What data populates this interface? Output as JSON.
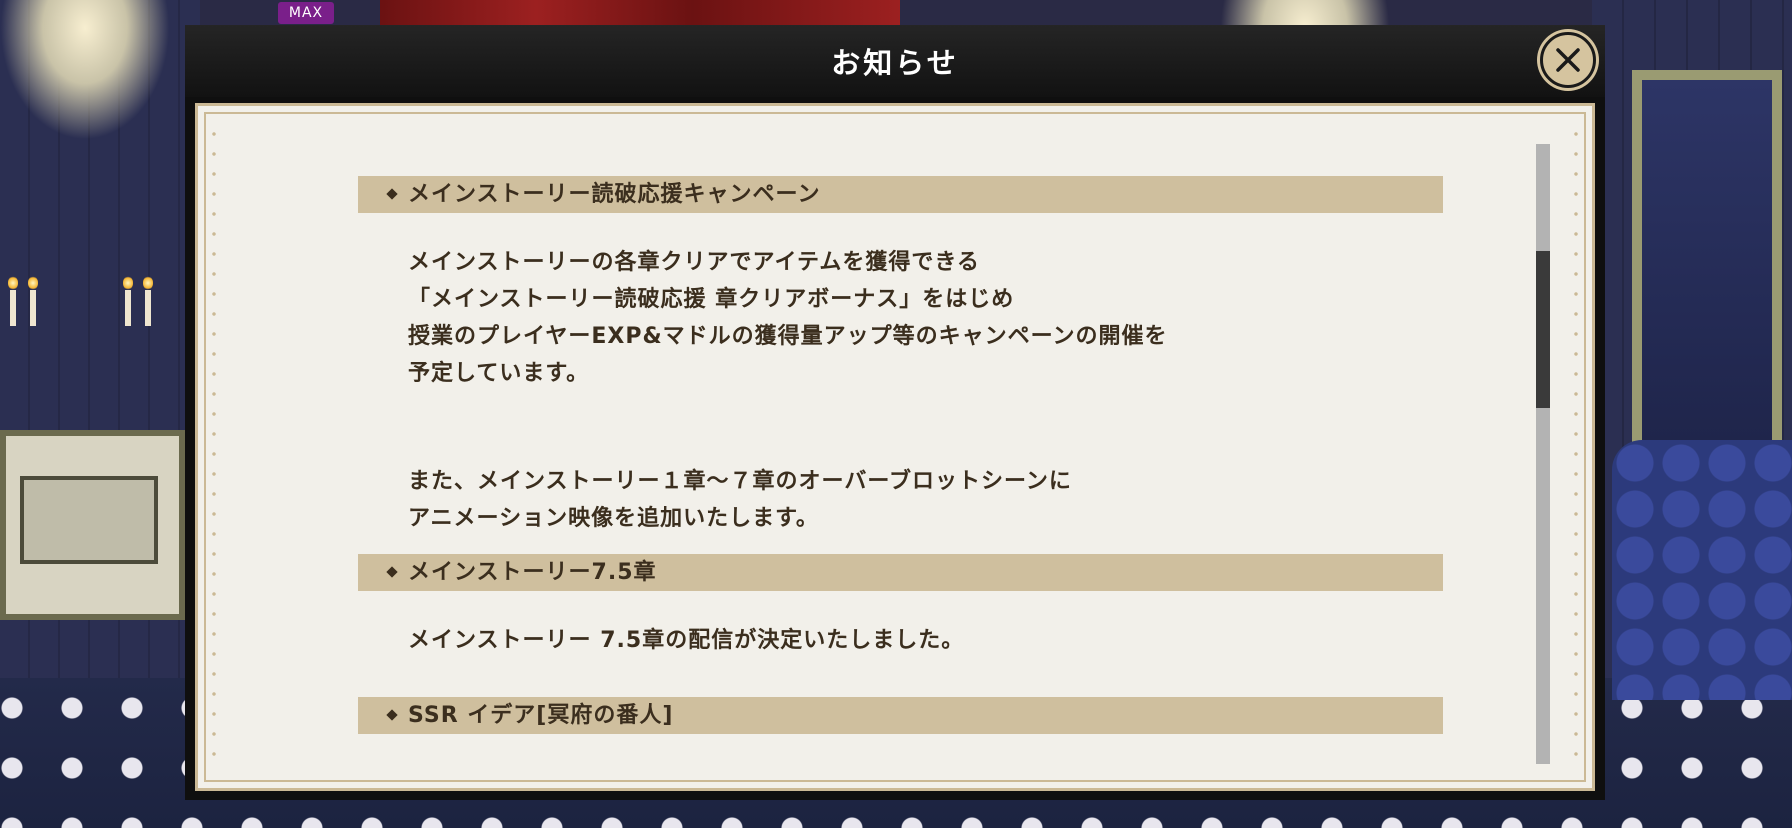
{
  "background": {
    "level_badge": "MAX"
  },
  "dialog": {
    "title": "お知らせ",
    "close_icon": "close-x-icon"
  },
  "sections": [
    {
      "header": "メインストーリー読破応援キャンペーン",
      "paragraphs": [
        [
          "メインストーリーの各章クリアでアイテムを獲得できる",
          "「メインストーリー読破応援 章クリアボーナス」をはじめ",
          "授業のプレイヤーEXP&マドルの獲得量アップ等のキャンペーンの開催を",
          "予定しています。"
        ],
        [
          "また、メインストーリー１章～７章のオーバーブロットシーンに",
          "アニメーション映像を追加いたします。"
        ]
      ]
    },
    {
      "header": "メインストーリー7.5章",
      "paragraphs": [
        [
          "メインストーリー 7.5章の配信が決定いたしました。"
        ]
      ]
    },
    {
      "header": "SSR イデア[冥府の番人]",
      "paragraphs": []
    }
  ],
  "colors": {
    "header_band": "#cfbf9e",
    "panel_bg": "#f2f0ea",
    "text": "#3b2e1e",
    "close_button": "#d5c49f"
  }
}
